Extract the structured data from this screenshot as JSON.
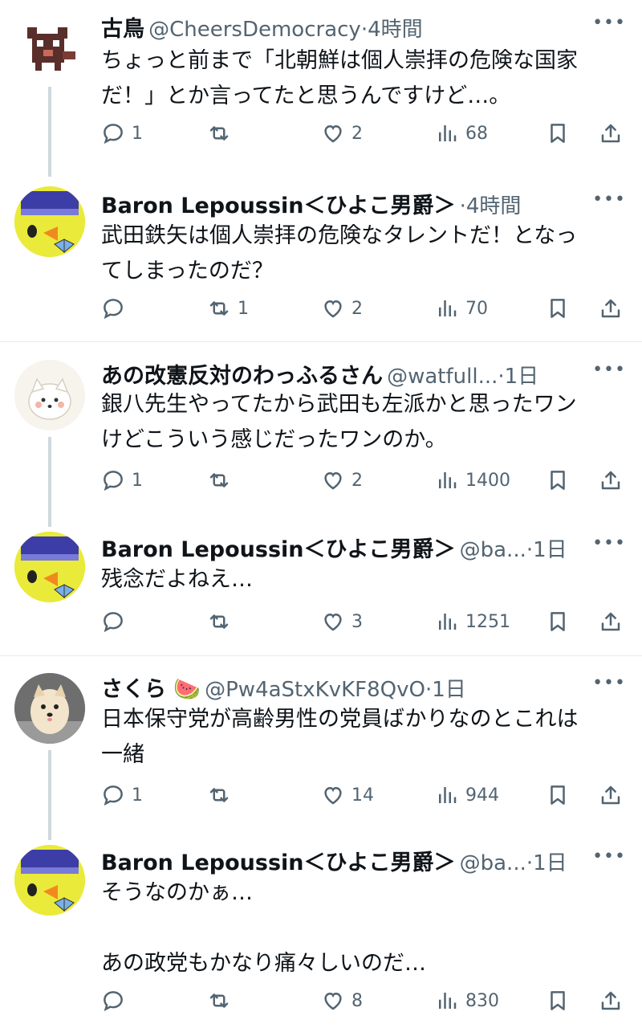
{
  "colors": {
    "text": "#0f1419",
    "muted": "#536471",
    "thread_line": "#cfd9de",
    "divider": "#e6ecf0"
  },
  "posts": [
    {
      "name": "古鳥",
      "handle": "@CheersDemocracy",
      "time": "4時間",
      "text": "ちょっと前まで「北朝鮮は個人崇拝の危険な国家\nだ！」とか言ってたと思うんですけど…。",
      "replies": "1",
      "reposts": "",
      "likes": "2",
      "views": "68",
      "avatar": "animal-pixel-icon"
    },
    {
      "name": "Baron Lepoussin＜ひよこ男爵＞",
      "handle": "",
      "time": "4時間",
      "text": "武田鉄矢は個人崇拝の危険なタレントだ！となっ\nてしまったのだ？",
      "replies": "",
      "reposts": "1",
      "likes": "2",
      "views": "70",
      "avatar": "chick-baron-icon"
    },
    {
      "name": "あの改憲反対のわっふるさん",
      "handle": "@watfull...",
      "time": "1日",
      "text": "銀八先生やってたから武田も左派かと思ったワン\nけどこういう感じだったワンのか。",
      "replies": "1",
      "reposts": "",
      "likes": "2",
      "views": "1400",
      "avatar": "white-dog-drawing-icon"
    },
    {
      "name": "Baron Lepoussin＜ひよこ男爵＞",
      "handle": "@ba...",
      "time": "1日",
      "text": "残念だよねえ…",
      "replies": "",
      "reposts": "",
      "likes": "3",
      "views": "1251",
      "avatar": "chick-baron-icon"
    },
    {
      "name": "さくら 🍉",
      "handle": "@Pw4aStxKvKF8QvO",
      "time": "1日",
      "text": "日本保守党が高齢男性の党員ばかりなのとこれは\n一緒",
      "replies": "1",
      "reposts": "",
      "likes": "14",
      "views": "944",
      "avatar": "pomeranian-photo"
    },
    {
      "name": "Baron Lepoussin＜ひよこ男爵＞",
      "handle": "@ba...",
      "time": "1日",
      "text": "そうなのかぁ…\n\nあの政党もかなり痛々しいのだ…",
      "replies": "",
      "reposts": "",
      "likes": "8",
      "views": "830",
      "avatar": "chick-baron-icon"
    }
  ]
}
